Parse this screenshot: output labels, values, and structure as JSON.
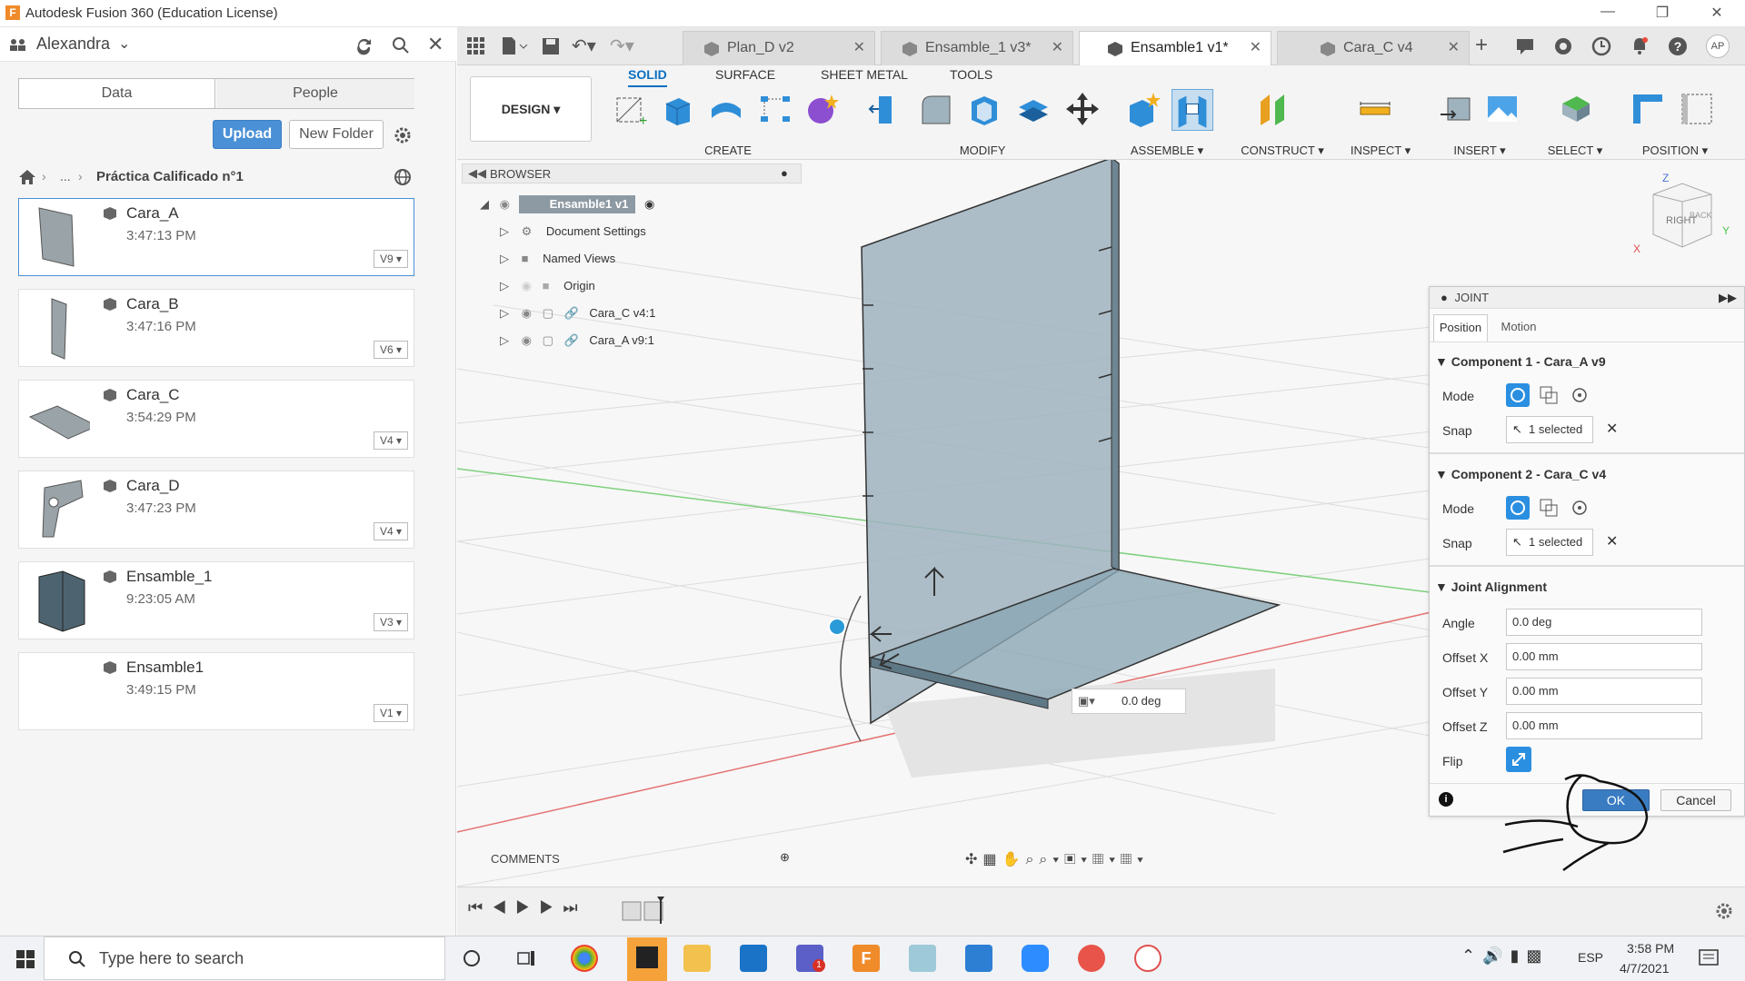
{
  "window": {
    "title": "Autodesk Fusion 360 (Education License)"
  },
  "left_panel": {
    "user": "Alexandra",
    "tab_data": "Data",
    "tab_people": "People",
    "upload": "Upload",
    "new_folder": "New Folder",
    "breadcrumb_ellipsis": "...",
    "breadcrumb_folder": "Práctica Calificado n°1",
    "files": [
      {
        "name": "Cara_A",
        "time": "3:47:13 PM",
        "version": "V9"
      },
      {
        "name": "Cara_B",
        "time": "3:47:16 PM",
        "version": "V6"
      },
      {
        "name": "Cara_C",
        "time": "3:54:29 PM",
        "version": "V4"
      },
      {
        "name": "Cara_D",
        "time": "3:47:23 PM",
        "version": "V4"
      },
      {
        "name": "Ensamble_1",
        "time": "9:23:05 AM",
        "version": "V3"
      },
      {
        "name": "Ensamble1",
        "time": "3:49:15 PM",
        "version": "V1"
      }
    ]
  },
  "doc_tabs": [
    {
      "label": "Plan_D v2"
    },
    {
      "label": "Ensamble_1 v3*"
    },
    {
      "label": "Ensamble1 v1*"
    },
    {
      "label": "Cara_C v4"
    }
  ],
  "ribbon": {
    "workspace": "DESIGN",
    "tabs": [
      "SOLID",
      "SURFACE",
      "SHEET METAL",
      "TOOLS"
    ],
    "groups": [
      "CREATE",
      "MODIFY",
      "ASSEMBLE",
      "CONSTRUCT",
      "INSPECT",
      "INSERT",
      "SELECT",
      "POSITION"
    ]
  },
  "browser": {
    "title": "BROWSER",
    "root": "Ensamble1 v1",
    "items": [
      "Document Settings",
      "Named Views",
      "Origin",
      "Cara_C v4:1",
      "Cara_A v9:1"
    ]
  },
  "viewcube": {
    "face_right": "RIGHT",
    "face_back": "BACK",
    "axis_z": "Z",
    "axis_x": "X",
    "axis_y": "Y"
  },
  "viewport": {
    "angle_readout": "0.0 deg"
  },
  "joint": {
    "title": "JOINT",
    "tab_position": "Position",
    "tab_motion": "Motion",
    "comp1_title": "Component 1 - Cara_A v9",
    "comp2_title": "Component 2 - Cara_C v4",
    "mode_label": "Mode",
    "snap_label": "Snap",
    "snap_value": "1 selected",
    "alignment_title": "Joint Alignment",
    "angle_label": "Angle",
    "angle_value": "0.0 deg",
    "offx_label": "Offset X",
    "offx_value": "0.00 mm",
    "offy_label": "Offset Y",
    "offy_value": "0.00 mm",
    "offz_label": "Offset Z",
    "offz_value": "0.00 mm",
    "flip_label": "Flip",
    "ok": "OK",
    "cancel": "Cancel"
  },
  "comments": {
    "title": "COMMENTS"
  },
  "taskbar": {
    "search_placeholder": "Type here to search",
    "lang": "ESP",
    "time": "3:58 PM",
    "date": "4/7/2021",
    "teams_badge": "1"
  },
  "colors": {
    "accent": "#0a6fc2",
    "part_fill": "#9fb3bf",
    "axis_red": "#e05050",
    "axis_green": "#4fc24f"
  }
}
